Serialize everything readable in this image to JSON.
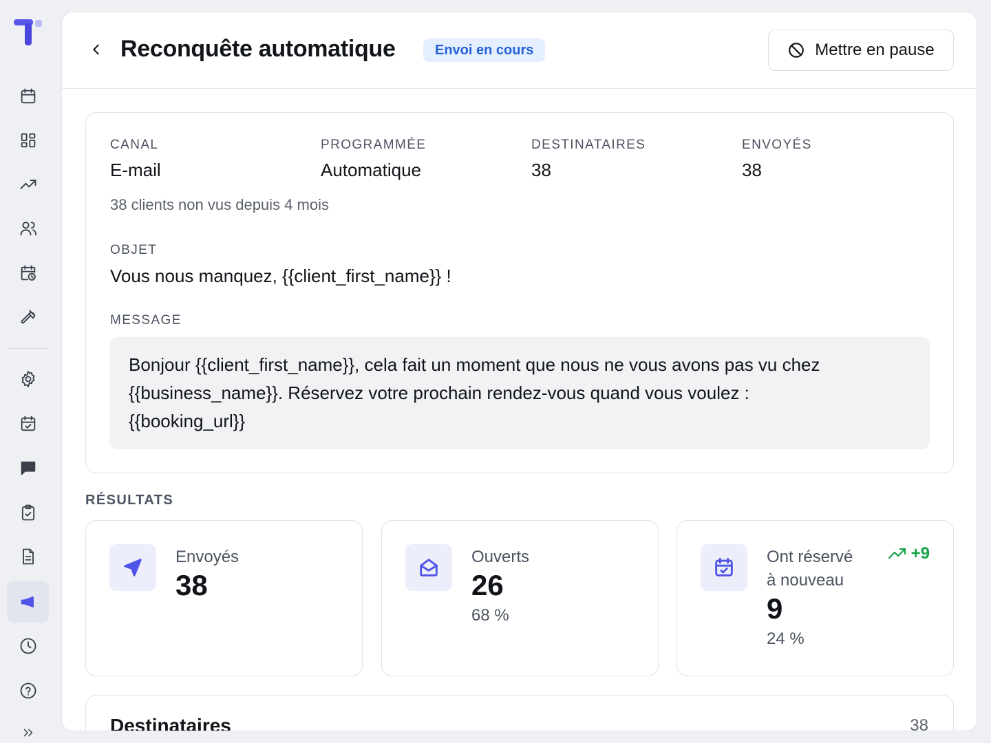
{
  "header": {
    "title": "Reconquête automatique",
    "status": "Envoi en cours",
    "pause_label": "Mettre en pause"
  },
  "sidebar": {
    "icons": [
      "calendar-icon",
      "dashboard-icon",
      "trending-icon",
      "users-icon",
      "schedule-icon",
      "tools-icon",
      "settings-icon",
      "calendar-check-icon",
      "chat-icon",
      "clipboard-icon",
      "document-icon",
      "megaphone-icon",
      "clock-icon",
      "help-icon",
      "expand-icon"
    ],
    "active": "megaphone-icon"
  },
  "info": {
    "canal_label": "CANAL",
    "canal_value": "E-mail",
    "programmee_label": "PROGRAMMÉE",
    "programmee_value": "Automatique",
    "destinataires_label": "DESTINATAIRES",
    "destinataires_value": "38",
    "envoyes_label": "ENVOYÉS",
    "envoyes_value": "38",
    "segment": "38 clients non vus depuis 4 mois",
    "objet_label": "OBJET",
    "objet_value": "Vous nous manquez, {{client_first_name}} !",
    "message_label": "MESSAGE",
    "message_line1": "Bonjour {{client_first_name}}, cela fait un moment que nous ne vous avons pas vu chez",
    "message_line2": "{{business_name}}. Réservez votre prochain rendez-vous quand vous voulez :",
    "message_line3": "{{booking_url}}"
  },
  "results": {
    "title": "RÉSULTATS",
    "sent": {
      "label": "Envoyés",
      "value": "38"
    },
    "opened": {
      "label": "Ouverts",
      "value": "26",
      "pct": "68 %"
    },
    "rebooked": {
      "label_line1": "Ont réservé",
      "label_line2": "à nouveau",
      "value": "9",
      "pct": "24 %",
      "trend": "+9"
    }
  },
  "recipients": {
    "title": "Destinataires",
    "count": "38"
  },
  "colors": {
    "accent": "#4f54e6",
    "badge_bg": "#e6efff",
    "badge_text": "#2563d6",
    "positive": "#16a34a"
  }
}
